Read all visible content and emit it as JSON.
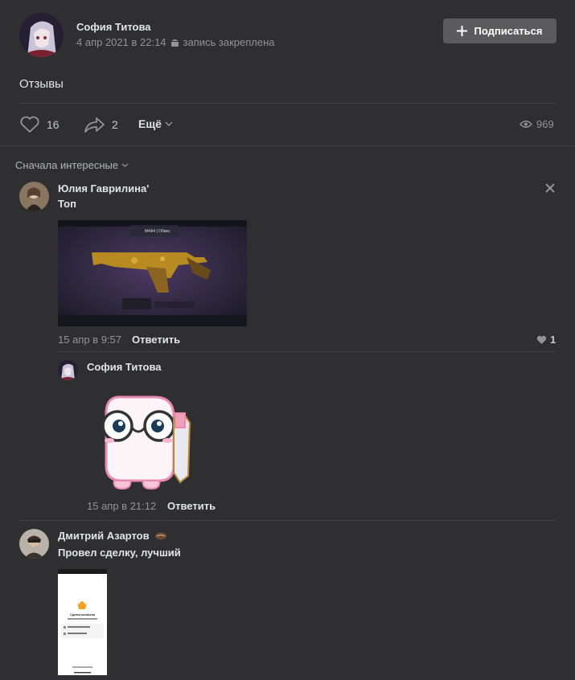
{
  "post": {
    "author": "София Титова",
    "date": "4 апр 2021 в 22:14",
    "pinned": "запись закреплена",
    "subscribe_label": "Подписаться",
    "text": "Отзывы",
    "likes": "16",
    "shares": "2",
    "more_label": "Ещё",
    "views": "969"
  },
  "comments": {
    "sort_label": "Сначала интересные",
    "items": [
      {
        "author": "Юлия Гаврилина'",
        "text": "Топ",
        "time": "15 апр в 9:57",
        "reply_label": "Ответить",
        "likes": "1",
        "image_text": "M4A4 | Обвес"
      },
      {
        "author": "София Титова",
        "time": "15 апр в 21:12",
        "reply_label": "Ответить"
      },
      {
        "author": "Дмитрий Азартов",
        "text": "Провел сделку, лучший",
        "phone_title": "Сделка оплачена"
      }
    ]
  },
  "colors": {
    "background": "#2f2f31",
    "text": "#e1e3e6",
    "muted": "#939393",
    "button": "#5b5b5d"
  }
}
